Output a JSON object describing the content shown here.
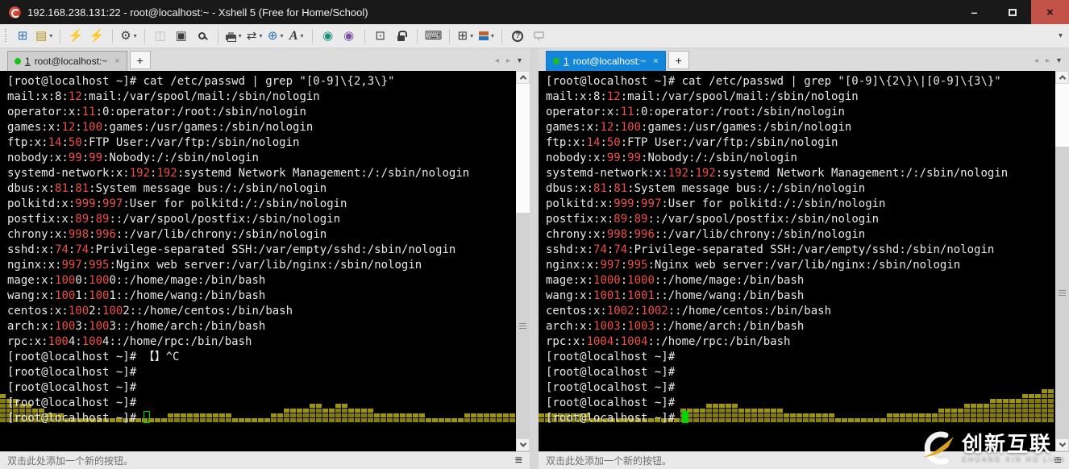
{
  "window": {
    "title": "192.168.238.131:22 - root@localhost:~ - Xshell 5 (Free for Home/School)",
    "minimize_glyph": "–",
    "close_glyph": "×"
  },
  "toolbar": {
    "overflow_glyph": "▾",
    "items": [
      {
        "name": "new-session-button",
        "glyph": "⊞",
        "color": "#2a72b5"
      },
      {
        "name": "open-session-button",
        "glyph": "▤",
        "color": "#b9951d",
        "dropdown": true
      },
      {
        "sep": true
      },
      {
        "name": "reconnect-button",
        "glyph": "⚡",
        "color": "#e0821e"
      },
      {
        "name": "disconnect-button",
        "glyph": "⚡",
        "color": "#bcbcbc",
        "disabled": true
      },
      {
        "sep": true
      },
      {
        "name": "session-properties-button",
        "glyph": "⚙",
        "color": "#3d3d3d",
        "dropdown": true
      },
      {
        "sep": true
      },
      {
        "name": "copy-button",
        "glyph": "◫",
        "color": "#bdbdbd",
        "disabled": true
      },
      {
        "name": "paste-button",
        "glyph": "▣",
        "color": "#3d3d3d"
      },
      {
        "name": "find-button",
        "shape": "magnifier"
      },
      {
        "sep": true
      },
      {
        "name": "print-button",
        "shape": "printer",
        "dropdown": true
      },
      {
        "name": "file-transfer-button",
        "glyph": "⇄",
        "color": "#3d3d3d",
        "dropdown": true
      },
      {
        "name": "web-browser-button",
        "glyph": "⊕",
        "color": "#2a72b5",
        "dropdown": true
      },
      {
        "name": "font-button",
        "glyph": "A",
        "color": "#3d3d3d",
        "dropdown": true,
        "serif": true
      },
      {
        "sep": true
      },
      {
        "name": "xagent-button",
        "glyph": "◉",
        "color": "#1a8f7a"
      },
      {
        "name": "xmanager-button",
        "glyph": "◉",
        "color": "#7a4f9e"
      },
      {
        "sep": true
      },
      {
        "name": "fullscreen-button",
        "glyph": "⊡",
        "color": "#3d3d3d"
      },
      {
        "name": "lock-screen-button",
        "shape": "lock"
      },
      {
        "sep": true
      },
      {
        "name": "virtual-keyboard-button",
        "glyph": "⌨",
        "color": "#3d3d3d"
      },
      {
        "sep": true
      },
      {
        "name": "new-terminal-button",
        "glyph": "⊞",
        "color": "#3d3d3d",
        "dropdown": true
      },
      {
        "name": "layout-button",
        "shape": "layout",
        "dropdown": true
      },
      {
        "sep": true
      },
      {
        "name": "help-button",
        "glyph": "?",
        "color": "#3d3d3d",
        "circled": true
      },
      {
        "name": "feedback-button",
        "shape": "bubble",
        "disabled": true
      }
    ]
  },
  "panes": [
    {
      "tab": {
        "index": "1",
        "label": "root@localhost:~",
        "close_glyph": "×"
      },
      "new_tab_glyph": "+",
      "nav": {
        "prev": "◂",
        "next": "▸",
        "menu": "▾"
      },
      "terminal": {
        "cursor": "hollow",
        "lines": [
          [
            [
              "w",
              "[root@localhost ~]# cat /etc/passwd | grep \"[0-9]\\{2,3\\}\""
            ]
          ],
          [
            [
              "w",
              "mail:x:8:"
            ],
            [
              "r",
              "12"
            ],
            [
              "w",
              ":mail:/var/spool/mail:/sbin/nologin"
            ]
          ],
          [
            [
              "w",
              "operator:x:"
            ],
            [
              "r",
              "11"
            ],
            [
              "w",
              ":0:operator:/root:/sbin/nologin"
            ]
          ],
          [
            [
              "w",
              "games:x:"
            ],
            [
              "r",
              "12"
            ],
            [
              "w",
              ":"
            ],
            [
              "r",
              "100"
            ],
            [
              "w",
              ":games:/usr/games:/sbin/nologin"
            ]
          ],
          [
            [
              "w",
              "ftp:x:"
            ],
            [
              "r",
              "14"
            ],
            [
              "w",
              ":"
            ],
            [
              "r",
              "50"
            ],
            [
              "w",
              ":FTP User:/var/ftp:/sbin/nologin"
            ]
          ],
          [
            [
              "w",
              "nobody:x:"
            ],
            [
              "r",
              "99"
            ],
            [
              "w",
              ":"
            ],
            [
              "r",
              "99"
            ],
            [
              "w",
              ":Nobody:/:/sbin/nologin"
            ]
          ],
          [
            [
              "w",
              "systemd-network:x:"
            ],
            [
              "r",
              "192"
            ],
            [
              "w",
              ":"
            ],
            [
              "r",
              "192"
            ],
            [
              "w",
              ":systemd Network Management:/:/sbin/nologin"
            ]
          ],
          [
            [
              "w",
              "dbus:x:"
            ],
            [
              "r",
              "81"
            ],
            [
              "w",
              ":"
            ],
            [
              "r",
              "81"
            ],
            [
              "w",
              ":System message bus:/:/sbin/nologin"
            ]
          ],
          [
            [
              "w",
              "polkitd:x:"
            ],
            [
              "r",
              "999"
            ],
            [
              "w",
              ":"
            ],
            [
              "r",
              "997"
            ],
            [
              "w",
              ":User for polkitd:/:/sbin/nologin"
            ]
          ],
          [
            [
              "w",
              "postfix:x:"
            ],
            [
              "r",
              "89"
            ],
            [
              "w",
              ":"
            ],
            [
              "r",
              "89"
            ],
            [
              "w",
              "::/var/spool/postfix:/sbin/nologin"
            ]
          ],
          [
            [
              "w",
              "chrony:x:"
            ],
            [
              "r",
              "998"
            ],
            [
              "w",
              ":"
            ],
            [
              "r",
              "996"
            ],
            [
              "w",
              "::/var/lib/chrony:/sbin/nologin"
            ]
          ],
          [
            [
              "w",
              "sshd:x:"
            ],
            [
              "r",
              "74"
            ],
            [
              "w",
              ":"
            ],
            [
              "r",
              "74"
            ],
            [
              "w",
              ":Privilege-separated SSH:/var/empty/sshd:/sbin/nologin"
            ]
          ],
          [
            [
              "w",
              "nginx:x:"
            ],
            [
              "r",
              "997"
            ],
            [
              "w",
              ":"
            ],
            [
              "r",
              "995"
            ],
            [
              "w",
              ":Nginx web server:/var/lib/nginx:/sbin/nologin"
            ]
          ],
          [
            [
              "w",
              "mage:x:"
            ],
            [
              "r",
              "100"
            ],
            [
              "w",
              "0:"
            ],
            [
              "r",
              "100"
            ],
            [
              "w",
              "0::/home/mage:/bin/bash"
            ]
          ],
          [
            [
              "w",
              "wang:x:"
            ],
            [
              "r",
              "100"
            ],
            [
              "w",
              "1:"
            ],
            [
              "r",
              "100"
            ],
            [
              "w",
              "1::/home/wang:/bin/bash"
            ]
          ],
          [
            [
              "w",
              "centos:x:"
            ],
            [
              "r",
              "100"
            ],
            [
              "w",
              "2:"
            ],
            [
              "r",
              "100"
            ],
            [
              "w",
              "2::/home/centos:/bin/bash"
            ]
          ],
          [
            [
              "w",
              "arch:x:"
            ],
            [
              "r",
              "100"
            ],
            [
              "w",
              "3:"
            ],
            [
              "r",
              "100"
            ],
            [
              "w",
              "3::/home/arch:/bin/bash"
            ]
          ],
          [
            [
              "w",
              "rpc:x:"
            ],
            [
              "r",
              "100"
            ],
            [
              "w",
              "4:"
            ],
            [
              "r",
              "100"
            ],
            [
              "w",
              "4::/home/rpc:/bin/bash"
            ]
          ],
          [
            [
              "w",
              "[root@localhost ~]# 【】^C"
            ]
          ],
          [
            [
              "w",
              "[root@localhost ~]#"
            ]
          ],
          [
            [
              "w",
              "[root@localhost ~]#"
            ]
          ],
          [
            [
              "w",
              "[root@localhost ~]#"
            ]
          ],
          [
            [
              "w",
              "[root@localhost ~]# "
            ]
          ]
        ]
      },
      "status_bar": {
        "hint": "双击此处添加一个新的按钮。",
        "menu_glyph": "≡"
      }
    },
    {
      "tab": {
        "index": "1",
        "label": "root@localhost:~",
        "close_glyph": "×"
      },
      "new_tab_glyph": "+",
      "nav": {
        "prev": "◂",
        "next": "▸",
        "menu": "▾"
      },
      "terminal": {
        "cursor": "block",
        "lines": [
          [
            [
              "w",
              "[root@localhost ~]# cat /etc/passwd | grep \"[0-9]\\{2\\}\\|[0-9]\\{3\\}\""
            ]
          ],
          [
            [
              "w",
              "mail:x:8:"
            ],
            [
              "r",
              "12"
            ],
            [
              "w",
              ":mail:/var/spool/mail:/sbin/nologin"
            ]
          ],
          [
            [
              "w",
              "operator:x:"
            ],
            [
              "r",
              "11"
            ],
            [
              "w",
              ":0:operator:/root:/sbin/nologin"
            ]
          ],
          [
            [
              "w",
              "games:x:"
            ],
            [
              "r",
              "12"
            ],
            [
              "w",
              ":"
            ],
            [
              "r",
              "100"
            ],
            [
              "w",
              ":games:/usr/games:/sbin/nologin"
            ]
          ],
          [
            [
              "w",
              "ftp:x:"
            ],
            [
              "r",
              "14"
            ],
            [
              "w",
              ":"
            ],
            [
              "r",
              "50"
            ],
            [
              "w",
              ":FTP User:/var/ftp:/sbin/nologin"
            ]
          ],
          [
            [
              "w",
              "nobody:x:"
            ],
            [
              "r",
              "99"
            ],
            [
              "w",
              ":"
            ],
            [
              "r",
              "99"
            ],
            [
              "w",
              ":Nobody:/:/sbin/nologin"
            ]
          ],
          [
            [
              "w",
              "systemd-network:x:"
            ],
            [
              "r",
              "192"
            ],
            [
              "w",
              ":"
            ],
            [
              "r",
              "192"
            ],
            [
              "w",
              ":systemd Network Management:/:/sbin/nologin"
            ]
          ],
          [
            [
              "w",
              "dbus:x:"
            ],
            [
              "r",
              "81"
            ],
            [
              "w",
              ":"
            ],
            [
              "r",
              "81"
            ],
            [
              "w",
              ":System message bus:/:/sbin/nologin"
            ]
          ],
          [
            [
              "w",
              "polkitd:x:"
            ],
            [
              "r",
              "999"
            ],
            [
              "w",
              ":"
            ],
            [
              "r",
              "997"
            ],
            [
              "w",
              ":User for polkitd:/:/sbin/nologin"
            ]
          ],
          [
            [
              "w",
              "postfix:x:"
            ],
            [
              "r",
              "89"
            ],
            [
              "w",
              ":"
            ],
            [
              "r",
              "89"
            ],
            [
              "w",
              "::/var/spool/postfix:/sbin/nologin"
            ]
          ],
          [
            [
              "w",
              "chrony:x:"
            ],
            [
              "r",
              "998"
            ],
            [
              "w",
              ":"
            ],
            [
              "r",
              "996"
            ],
            [
              "w",
              "::/var/lib/chrony:/sbin/nologin"
            ]
          ],
          [
            [
              "w",
              "sshd:x:"
            ],
            [
              "r",
              "74"
            ],
            [
              "w",
              ":"
            ],
            [
              "r",
              "74"
            ],
            [
              "w",
              ":Privilege-separated SSH:/var/empty/sshd:/sbin/nologin"
            ]
          ],
          [
            [
              "w",
              "nginx:x:"
            ],
            [
              "r",
              "997"
            ],
            [
              "w",
              ":"
            ],
            [
              "r",
              "995"
            ],
            [
              "w",
              ":Nginx web server:/var/lib/nginx:/sbin/nologin"
            ]
          ],
          [
            [
              "w",
              "mage:x:"
            ],
            [
              "r",
              "1000"
            ],
            [
              "w",
              ":"
            ],
            [
              "r",
              "1000"
            ],
            [
              "w",
              "::/home/mage:/bin/bash"
            ]
          ],
          [
            [
              "w",
              "wang:x:"
            ],
            [
              "r",
              "1001"
            ],
            [
              "w",
              ":"
            ],
            [
              "r",
              "1001"
            ],
            [
              "w",
              "::/home/wang:/bin/bash"
            ]
          ],
          [
            [
              "w",
              "centos:x:"
            ],
            [
              "r",
              "1002"
            ],
            [
              "w",
              ":"
            ],
            [
              "r",
              "1002"
            ],
            [
              "w",
              "::/home/centos:/bin/bash"
            ]
          ],
          [
            [
              "w",
              "arch:x:"
            ],
            [
              "r",
              "1003"
            ],
            [
              "w",
              ":"
            ],
            [
              "r",
              "1003"
            ],
            [
              "w",
              "::/home/arch:/bin/bash"
            ]
          ],
          [
            [
              "w",
              "rpc:x:"
            ],
            [
              "r",
              "1004"
            ],
            [
              "w",
              ":"
            ],
            [
              "r",
              "1004"
            ],
            [
              "w",
              "::/home/rpc:/bin/bash"
            ]
          ],
          [
            [
              "w",
              "[root@localhost ~]#"
            ]
          ],
          [
            [
              "w",
              "[root@localhost ~]#"
            ]
          ],
          [
            [
              "w",
              "[root@localhost ~]#"
            ]
          ],
          [
            [
              "w",
              "[root@localhost ~]#"
            ]
          ],
          [
            [
              "w",
              "[root@localhost ~]# "
            ]
          ]
        ]
      },
      "status_bar": {
        "hint": "双击此处添加一个新的按钮。",
        "menu_glyph": "≡"
      }
    }
  ],
  "watermark": {
    "title_cn": "创新互联",
    "subtitle_en": "CHUANG XIN HU LIAN"
  },
  "colors": {
    "terminal_bg": "#000000",
    "terminal_fg": "#e8e8e8",
    "grep_match_red": "#ee5045",
    "cursor_green": "#00d400",
    "active_tab_blue": "#1386dc",
    "titlebar_bg": "#191919",
    "close_button_red": "#c35249",
    "equalizer_olive": "#857d07"
  }
}
